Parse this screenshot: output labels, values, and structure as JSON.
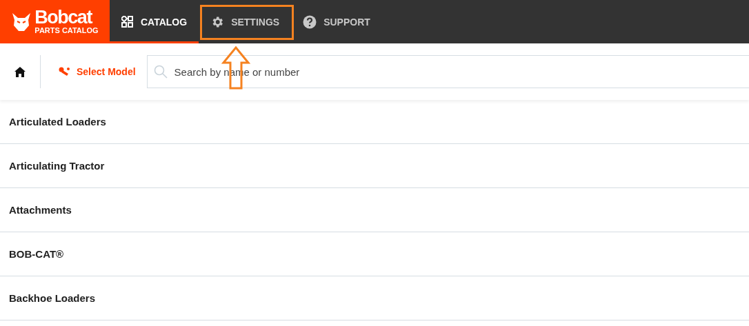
{
  "brand": {
    "name": "Bobcat",
    "subtitle": "PARTS CATALOG"
  },
  "nav": [
    {
      "label": "CATALOG",
      "kind": "catalog",
      "selected": true,
      "annotated": false
    },
    {
      "label": "SETTINGS",
      "kind": "settings",
      "selected": false,
      "annotated": true
    },
    {
      "label": "SUPPORT",
      "kind": "support",
      "selected": false,
      "annotated": false
    }
  ],
  "toolbar": {
    "select_model": "Select Model",
    "search": {
      "placeholder": "Search by name or number"
    }
  },
  "categories": [
    {
      "label": "Articulated Loaders"
    },
    {
      "label": "Articulating Tractor"
    },
    {
      "label": "Attachments"
    },
    {
      "label": "BOB-CAT®"
    },
    {
      "label": "Backhoe Loaders"
    }
  ]
}
